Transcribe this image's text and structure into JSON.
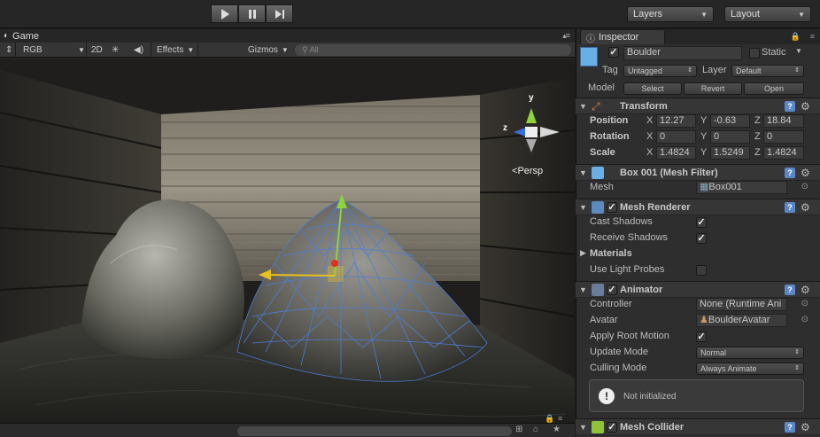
{
  "toolbar": {
    "play_icon": "play-icon",
    "pause_icon": "pause-icon",
    "step_icon": "step-icon",
    "layers_label": "Layers",
    "layout_label": "Layout"
  },
  "game": {
    "tab_label": "Game",
    "display_label": "RGB",
    "mode_2d_label": "2D",
    "effects_label": "Effects",
    "gizmos_label": "Gizmos",
    "search_placeholder": "All",
    "persp_label": "Persp",
    "axis_y": "y",
    "axis_z": "z"
  },
  "inspector": {
    "tab_label": "Inspector",
    "object_name": "Boulder",
    "static_label": "Static",
    "tag_label": "Tag",
    "tag_value": "Untagged",
    "layer_label": "Layer",
    "layer_value": "Default",
    "model_label": "Model",
    "select_label": "Select",
    "revert_label": "Revert",
    "open_label": "Open",
    "transform": {
      "title": "Transform",
      "position_label": "Position",
      "rotation_label": "Rotation",
      "scale_label": "Scale",
      "x": "X",
      "y": "Y",
      "z": "Z",
      "position": [
        "12.27",
        "-0.63",
        "18.84"
      ],
      "rotation": [
        "0",
        "0",
        "0"
      ],
      "scale": [
        "1.4824",
        "1.5249",
        "1.4824"
      ]
    },
    "mesh_filter": {
      "title": "Box 001 (Mesh Filter)",
      "mesh_label": "Mesh",
      "mesh_value": "Box001"
    },
    "mesh_renderer": {
      "title": "Mesh Renderer",
      "cast_shadows_label": "Cast Shadows",
      "receive_shadows_label": "Receive Shadows",
      "materials_label": "Materials",
      "use_light_probes_label": "Use Light Probes"
    },
    "animator": {
      "title": "Animator",
      "controller_label": "Controller",
      "controller_value": "None (Runtime Ani",
      "avatar_label": "Avatar",
      "avatar_value": "BoulderAvatar",
      "apply_root_motion_label": "Apply Root Motion",
      "update_mode_label": "Update Mode",
      "update_mode_value": "Normal",
      "culling_mode_label": "Culling Mode",
      "culling_mode_value": "Always Animate",
      "help_text": "Not initialized"
    },
    "mesh_collider": {
      "title": "Mesh Collider"
    }
  },
  "colors": {
    "axis_x": "#e8c020",
    "axis_y": "#8fd33a",
    "axis_z": "#3b6be0",
    "wireframe": "#4b7fd8",
    "help_icon": "#5b87c9"
  }
}
